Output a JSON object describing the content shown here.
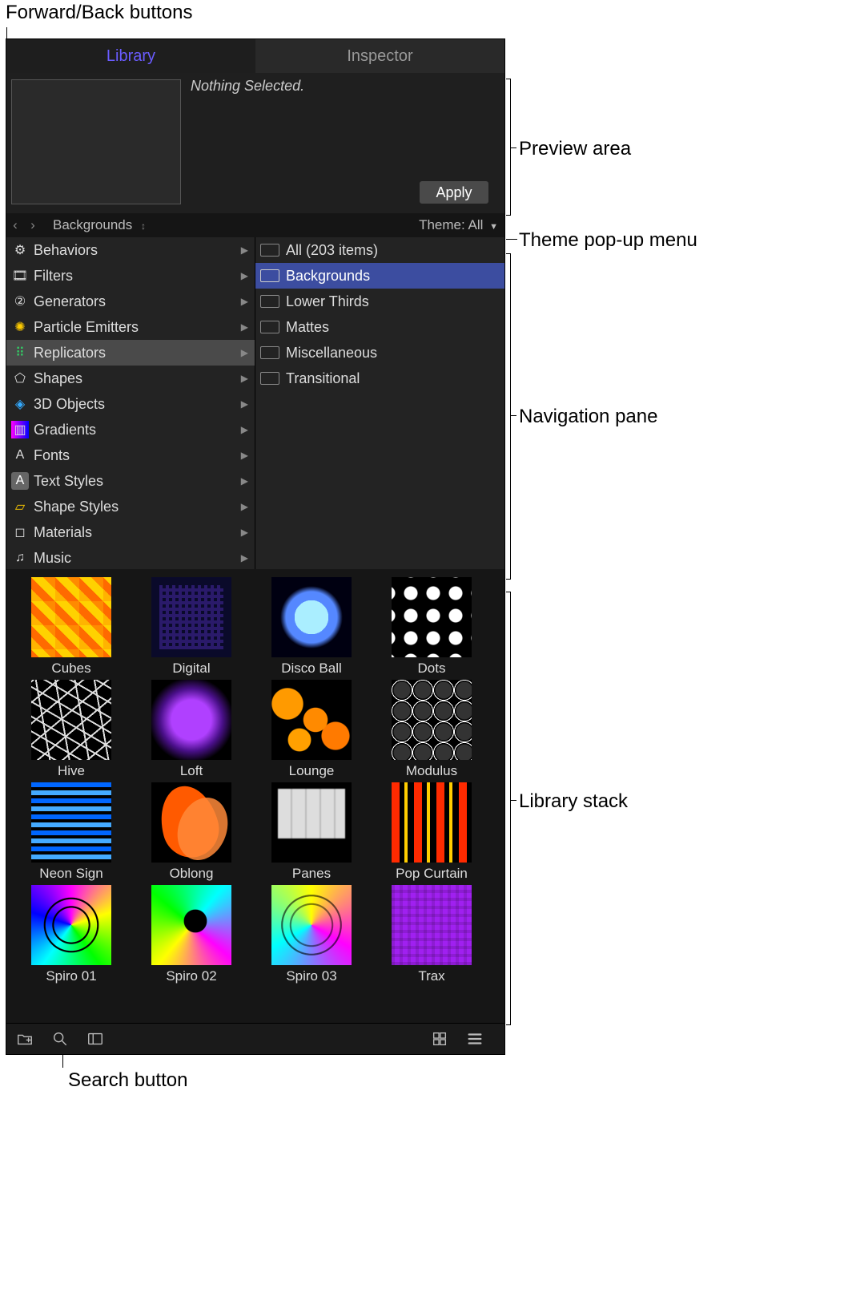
{
  "callouts": {
    "forward_back": "Forward/Back buttons",
    "preview_area": "Preview area",
    "theme_popup": "Theme pop-up menu",
    "navigation_pane": "Navigation pane",
    "library_stack": "Library stack",
    "search_button": "Search button"
  },
  "tabs": {
    "library": "Library",
    "inspector": "Inspector"
  },
  "preview": {
    "status": "Nothing Selected.",
    "apply": "Apply"
  },
  "navbar": {
    "path": "Backgrounds",
    "theme_label": "Theme: All"
  },
  "categories": [
    {
      "label": "Behaviors",
      "icon": "gear"
    },
    {
      "label": "Filters",
      "icon": "film"
    },
    {
      "label": "Generators",
      "icon": "gen"
    },
    {
      "label": "Particle Emitters",
      "icon": "emitter"
    },
    {
      "label": "Replicators",
      "icon": "repl",
      "selected": true
    },
    {
      "label": "Shapes",
      "icon": "shape"
    },
    {
      "label": "3D Objects",
      "icon": "cube"
    },
    {
      "label": "Gradients",
      "icon": "grad"
    },
    {
      "label": "Fonts",
      "icon": "font"
    },
    {
      "label": "Text Styles",
      "icon": "textstyle"
    },
    {
      "label": "Shape Styles",
      "icon": "shapestyle"
    },
    {
      "label": "Materials",
      "icon": "material"
    },
    {
      "label": "Music",
      "icon": "music"
    }
  ],
  "subfolders": [
    {
      "label": "All (203 items)"
    },
    {
      "label": "Backgrounds",
      "selected": true
    },
    {
      "label": "Lower Thirds"
    },
    {
      "label": "Mattes"
    },
    {
      "label": "Miscellaneous"
    },
    {
      "label": "Transitional"
    }
  ],
  "stack": [
    [
      "Cubes",
      "Digital",
      "Disco Ball",
      "Dots"
    ],
    [
      "Hive",
      "Loft",
      "Lounge",
      "Modulus"
    ],
    [
      "Neon Sign",
      "Oblong",
      "Panes",
      "Pop Curtain"
    ],
    [
      "Spiro 01",
      "Spiro 02",
      "Spiro 03",
      "Trax"
    ]
  ],
  "swatch_classes": [
    [
      "cubes",
      "digital",
      "disco",
      "dots"
    ],
    [
      "hive",
      "loft",
      "lounge",
      "modulus"
    ],
    [
      "neon",
      "oblong",
      "panes",
      "pop"
    ],
    [
      "spiro1",
      "spiro2",
      "spiro3",
      "trax"
    ]
  ],
  "icons": {
    "gear": "⚙︎",
    "film": "🎞",
    "gen": "②",
    "emitter": "✺",
    "repl": "⠿",
    "shape": "⬠",
    "cube": "◈",
    "grad": "▥",
    "font": "A",
    "textstyle": "A",
    "shapestyle": "▱",
    "material": "◻",
    "music": "♫"
  }
}
